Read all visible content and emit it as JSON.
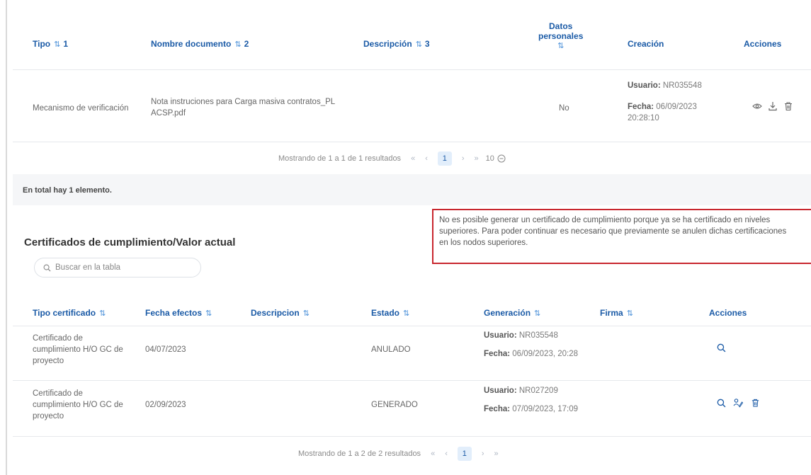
{
  "documents": {
    "headers": {
      "tipo": "Tipo",
      "tipo_num": "1",
      "nombre": "Nombre documento",
      "nombre_num": "2",
      "descripcion": "Descripción",
      "descripcion_num": "3",
      "datos_line1": "Datos",
      "datos_line2": "personales",
      "creacion": "Creación",
      "acciones": "Acciones"
    },
    "row": {
      "tipo": "Mecanismo de verificación",
      "nombre_line1": "Nota instruciones para Carga masiva contratos_PL",
      "nombre_line2": "ACSP.pdf",
      "datos_personales": "No",
      "usuario_label": "Usuario:",
      "usuario_value": "NR035548",
      "fecha_label": "Fecha:",
      "fecha_value": "06/09/2023",
      "fecha_time": "20:28:10"
    },
    "pager": {
      "summary": "Mostrando de 1 a 1 de 1 resultados",
      "first": "«",
      "prev": "‹",
      "page": "1",
      "next": "›",
      "last": "»",
      "page_size": "10"
    },
    "total": "En total hay 1 elemento."
  },
  "certificates": {
    "title": "Certificados de cumplimiento/Valor actual",
    "search_placeholder": "Buscar en la tabla",
    "warning": [
      "No es posible generar un certificado de cumplimiento porque ya se ha certificado en niveles",
      "superiores. Para poder continuar es necesario que previamente se anulen dichas certificaciones",
      "en los nodos superiores."
    ],
    "headers": {
      "tipo": "Tipo certificado",
      "fecha": "Fecha efectos",
      "descripcion": "Descripcion",
      "estado": "Estado",
      "generacion": "Generación",
      "firma": "Firma",
      "acciones": "Acciones"
    },
    "rows": [
      {
        "tipo": [
          "Certificado de",
          "cumplimiento H/O GC de",
          "proyecto"
        ],
        "fecha": "04/07/2023",
        "estado": "ANULADO",
        "usuario_label": "Usuario:",
        "usuario_value": "NR035548",
        "fecha_label": "Fecha:",
        "fecha_value": "06/09/2023, 20:28"
      },
      {
        "tipo": [
          "Certificado de",
          "cumplimiento H/O GC de",
          "proyecto"
        ],
        "fecha": "02/09/2023",
        "estado": "GENERADO",
        "usuario_label": "Usuario:",
        "usuario_value": "NR027209",
        "fecha_label": "Fecha:",
        "fecha_value": "07/09/2023, 17:09"
      }
    ],
    "pager": {
      "summary": "Mostrando de 1 a 2 de 2 resultados",
      "first": "«",
      "prev": "‹",
      "page": "1",
      "next": "›",
      "last": "»"
    }
  },
  "icons": {
    "sort": "sort-icon",
    "view": "eye-icon",
    "download": "download-icon",
    "delete": "trash-icon",
    "search": "search-icon",
    "sign": "signature-icon",
    "collapse": "circle-minus-icon"
  },
  "colors": {
    "accent": "#1a5aa6",
    "warning_border": "#c8262e",
    "page_bg": "#f5f6f8"
  }
}
